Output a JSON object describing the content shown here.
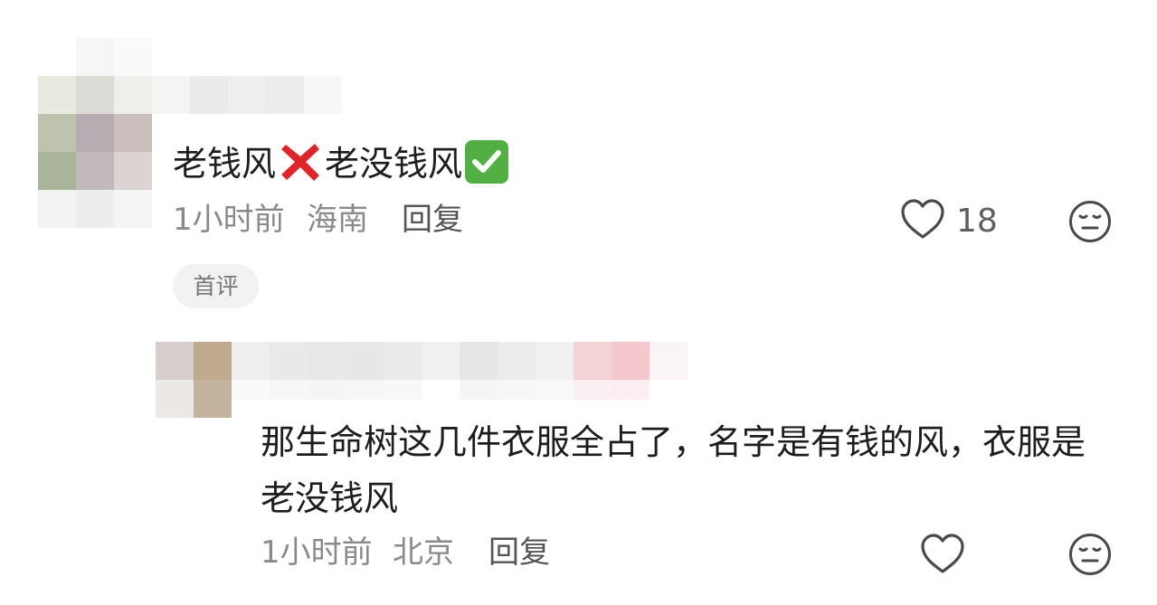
{
  "comments": [
    {
      "text_part1": "老钱风",
      "text_part2": "老没钱风",
      "emoji_1": "cross-mark-icon",
      "emoji_2": "check-mark-button-icon",
      "time": "1小时前",
      "location": "海南",
      "reply_label": "回复",
      "like_count": "18",
      "badge": "首评"
    }
  ],
  "replies": [
    {
      "text": "那生命树这几件衣服全占了，名字是有钱的风，衣服是老没钱风",
      "time": "1小时前",
      "location": "北京",
      "reply_label": "回复"
    }
  ],
  "colors": {
    "meta": "#8a8a8a",
    "badge_bg": "#f2f2f2",
    "cross_red": "#e0242a",
    "check_green": "#52b043"
  }
}
